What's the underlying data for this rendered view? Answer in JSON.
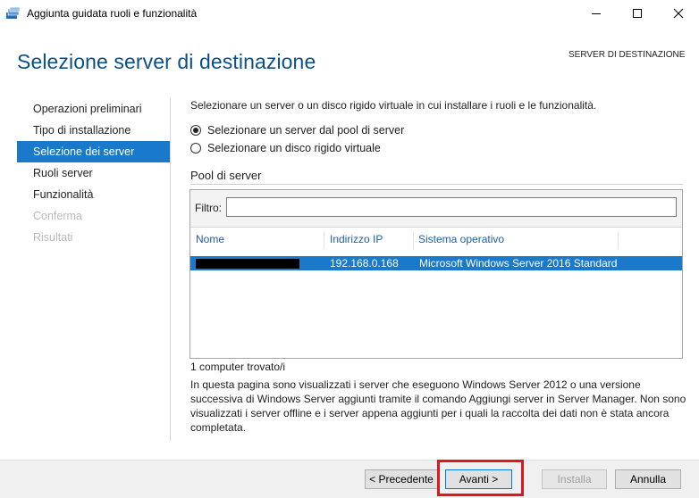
{
  "window": {
    "title": "Aggiunta guidata ruoli e funzionalità",
    "minimize_icon": "minimize-icon",
    "maximize_icon": "maximize-icon",
    "close_icon": "close-icon"
  },
  "header": {
    "page_title": "Selezione server di destinazione",
    "destination_label": "SERVER DI DESTINAZIONE"
  },
  "nav": {
    "items": [
      {
        "label": "Operazioni preliminari",
        "state": "normal"
      },
      {
        "label": "Tipo di installazione",
        "state": "normal"
      },
      {
        "label": "Selezione dei server",
        "state": "active"
      },
      {
        "label": "Ruoli server",
        "state": "normal"
      },
      {
        "label": "Funzionalità",
        "state": "normal"
      },
      {
        "label": "Conferma",
        "state": "disabled"
      },
      {
        "label": "Risultati",
        "state": "disabled"
      }
    ]
  },
  "main": {
    "intro": "Selezionare un server o un disco rigido virtuale in cui installare i ruoli e le funzionalità.",
    "options": [
      {
        "label": "Selezionare un server dal pool di server",
        "checked": true
      },
      {
        "label": "Selezionare un disco rigido virtuale",
        "checked": false
      }
    ],
    "pool": {
      "title": "Pool di server",
      "filter_label": "Filtro:",
      "filter_value": "",
      "columns": [
        "Nome",
        "Indirizzo IP",
        "Sistema operativo"
      ],
      "rows": [
        {
          "name": "",
          "ip": "192.168.0.168",
          "os": "Microsoft Windows Server 2016 Standard",
          "selected": true
        }
      ]
    },
    "found": "1 computer trovato/i",
    "description": "In questa pagina sono visualizzati i server che eseguono Windows Server 2012 o una versione successiva di Windows Server aggiunti tramite il comando Aggiungi server in Server Manager. Non sono visualizzati i server offline e i server appena aggiunti per i quali la raccolta dei dati non è stata ancora completata."
  },
  "footer": {
    "back": "< Precedente",
    "next": "Avanti >",
    "install": "Installa",
    "cancel": "Annulla"
  },
  "colors": {
    "accent": "#1979ca",
    "title": "#0a4f86",
    "highlight": "#e0161c"
  }
}
